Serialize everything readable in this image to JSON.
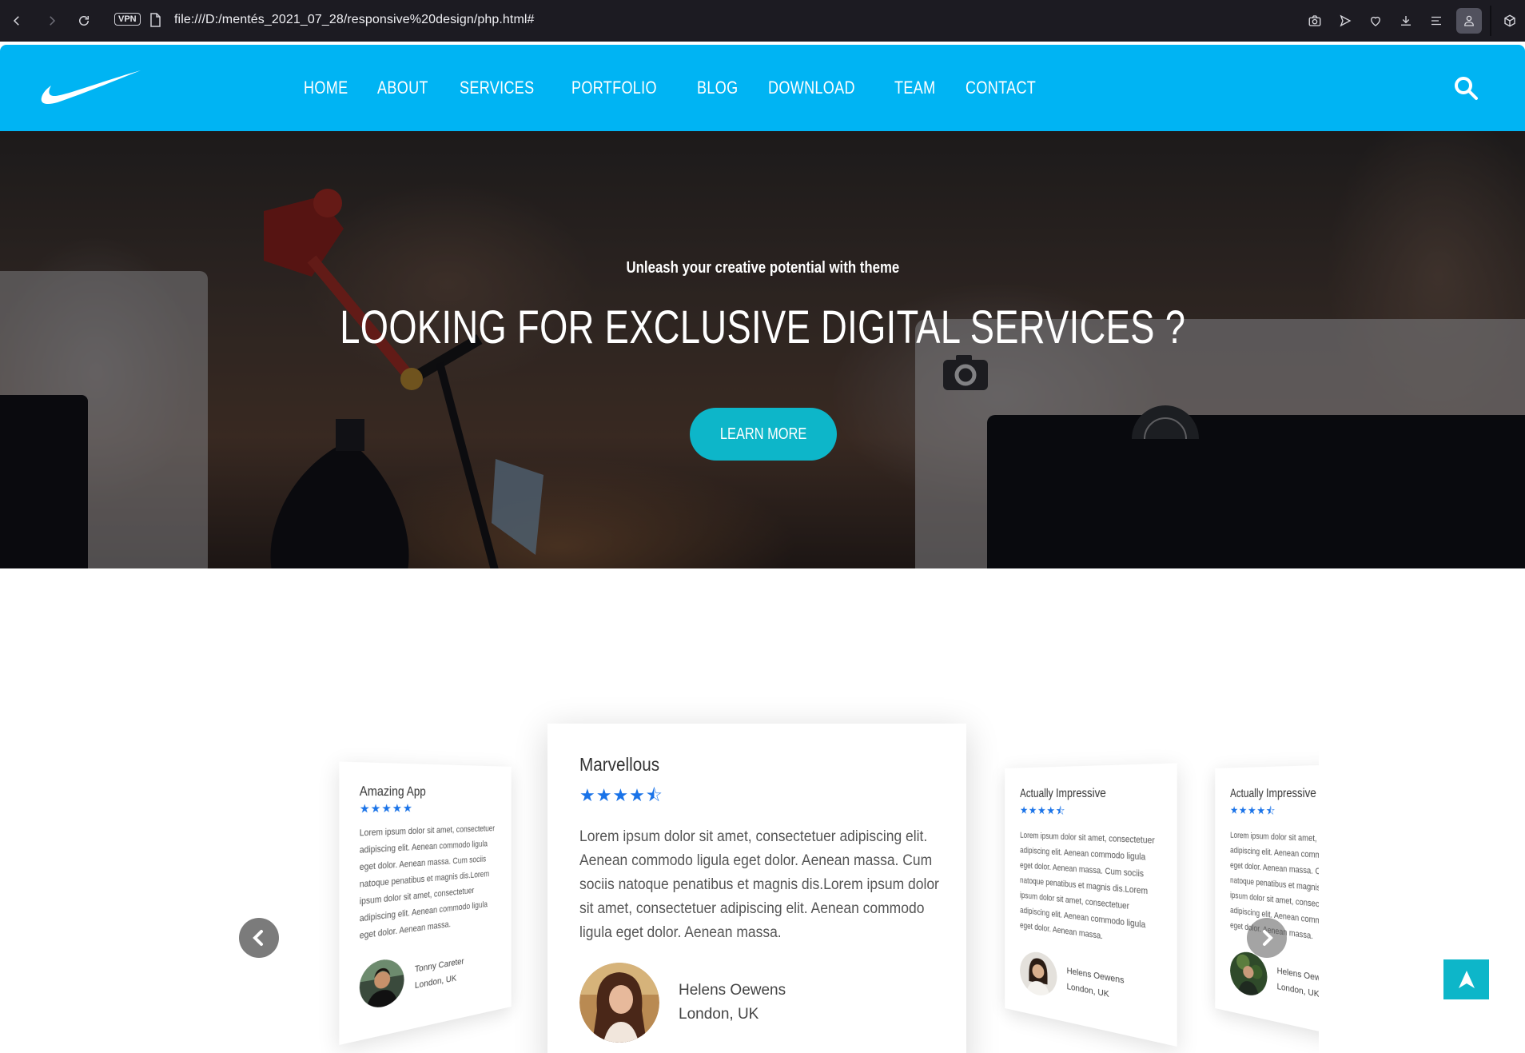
{
  "browser": {
    "vpn_label": "VPN",
    "url": "file:///D:/mentés_2021_07_28/responsive%20design/php.html#"
  },
  "header": {
    "logo_icon": "swoosh-logo-icon",
    "nav": [
      {
        "label": "HOME"
      },
      {
        "label": "ABOUT"
      },
      {
        "label": "SERVICES"
      },
      {
        "label": "PORTFOLIO"
      },
      {
        "label": "BLOG"
      },
      {
        "label": "DOWNLOAD"
      },
      {
        "label": "TEAM"
      },
      {
        "label": "CONTACT"
      }
    ],
    "search_icon": "search-icon",
    "background_color": "#00b4f3"
  },
  "hero": {
    "subtitle": "Unleash your creative potential with theme",
    "title": "LOOKING FOR EXCLUSIVE DIGITAL SERVICES ?",
    "cta_label": "LEARN MORE",
    "cta_color": "#0db6c9"
  },
  "testimonials": {
    "center": {
      "title": "Marvellous",
      "stars": "★★★★⯪",
      "rating": 4.5,
      "body": "Lorem ipsum dolor sit amet, consectetuer adipiscing elit. Aenean commodo ligula eget dolor. Aenean massa. Cum sociis natoque penatibus et magnis dis.Lorem ipsum dolor sit amet, consectetuer adipiscing elit. Aenean commodo ligula eget dolor. Aenean massa.",
      "author_name": "Helens Oewens",
      "author_location": "London, UK"
    },
    "left": {
      "title": "Amazing App",
      "stars": "★★★★★",
      "rating": 5,
      "body": "Lorem ipsum dolor sit amet, consectetuer adipiscing elit. Aenean commodo ligula eget dolor. Aenean massa. Cum sociis natoque penatibus et magnis dis.Lorem ipsum dolor sit amet, consectetuer adipiscing elit. Aenean commodo ligula eget dolor. Aenean massa.",
      "author_name": "Tonny Careter",
      "author_location": "London, UK"
    },
    "right1": {
      "title": "Actually Impressive",
      "stars": "★★★★⯪",
      "rating": 4.5,
      "body": "Lorem ipsum dolor sit amet, consectetuer adipiscing elit. Aenean commodo ligula eget dolor. Aenean massa. Cum sociis natoque penatibus et magnis dis.Lorem ipsum dolor sit amet, consectetuer adipiscing elit. Aenean commodo ligula eget dolor. Aenean massa.",
      "author_name": "Helens Oewens",
      "author_location": "London, UK"
    },
    "right2": {
      "title": "Actually Impressive",
      "stars": "★★★★⯪",
      "rating": 4.5,
      "body": "Lorem ipsum dolor sit amet, consectetuer adipiscing elit. Aenean commodo ligula eget dolor. Aenean massa. Cum sociis natoque penatibus et magnis dis.Lorem ipsum dolor sit amet, consectetuer adipiscing elit. Aenean commodo ligula eget dolor. Aenean massa.",
      "author_name": "Helens Oewens",
      "author_location": "London, UK"
    },
    "star_color": "#1a73e8"
  },
  "scroll_top_icon": "arrow-up-icon"
}
